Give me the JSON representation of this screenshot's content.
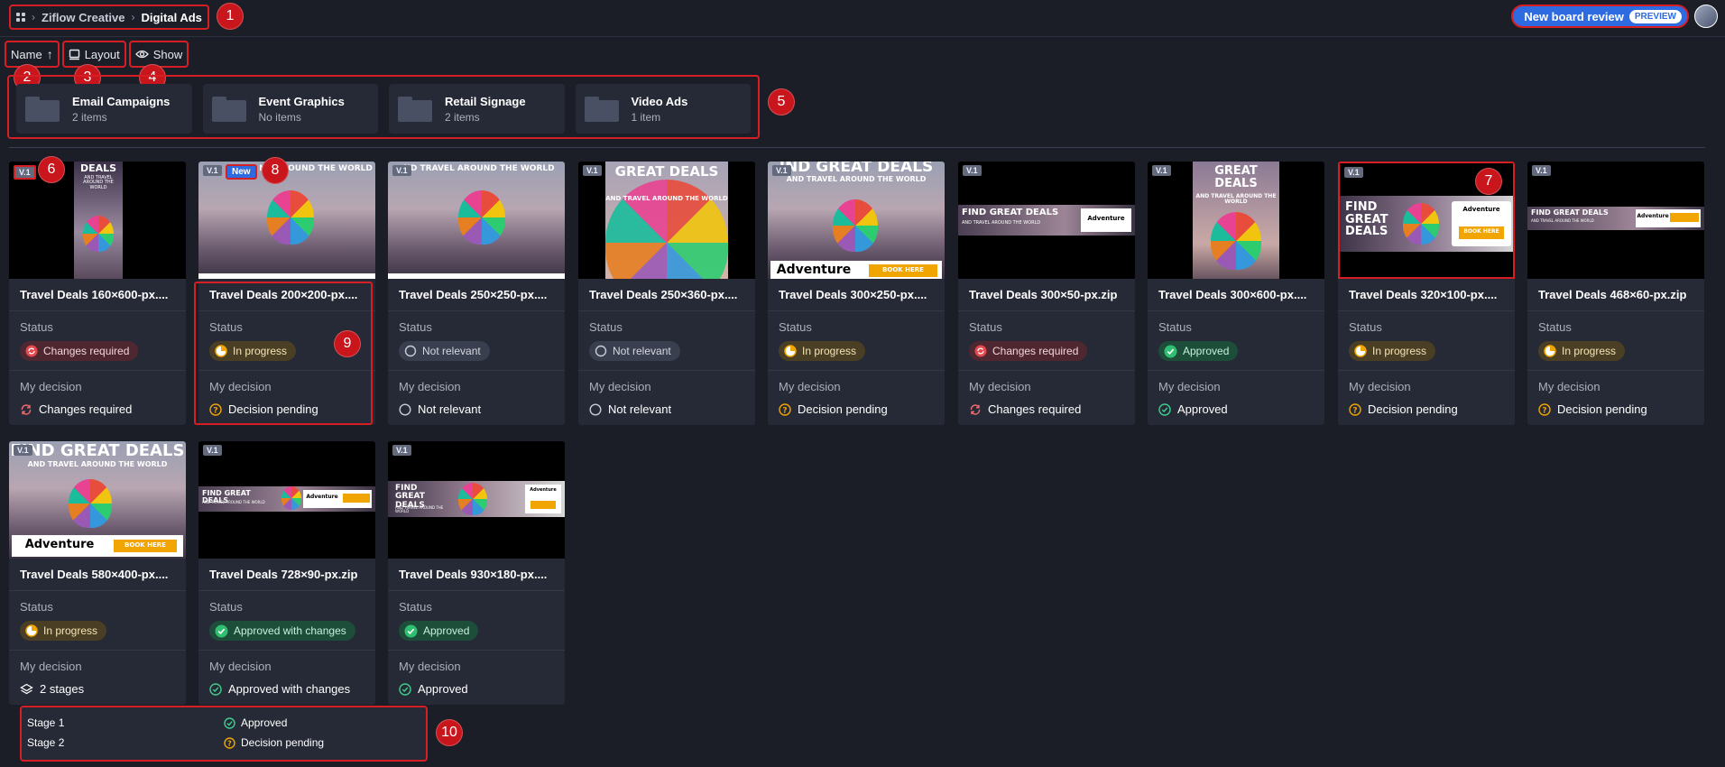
{
  "breadcrumb": {
    "items": [
      "Ziflow Creative",
      "Digital Ads"
    ]
  },
  "header": {
    "review_button": "New board review",
    "preview_pill": "PREVIEW"
  },
  "toolbar": {
    "sort_label": "Name",
    "sort_arrow": "↑",
    "layout_label": "Layout",
    "show_label": "Show"
  },
  "folders": [
    {
      "name": "Email Campaigns",
      "count": "2 items"
    },
    {
      "name": "Event Graphics",
      "count": "No items"
    },
    {
      "name": "Retail Signage",
      "count": "2 items"
    },
    {
      "name": "Video Ads",
      "count": "1 item"
    }
  ],
  "labels": {
    "status": "Status",
    "decision": "My decision"
  },
  "assets": [
    {
      "title": "Travel Deals 160×600-px....",
      "version": "V.1",
      "status": "Changes required",
      "status_color": "red",
      "decision": "Changes required",
      "decision_icon": "refresh-icon"
    },
    {
      "title": "Travel Deals 200×200-px....",
      "version": "V.1",
      "new_badge": "New",
      "status": "In progress",
      "status_color": "yellow",
      "decision": "Decision pending",
      "decision_icon": "question-icon"
    },
    {
      "title": "Travel Deals 250×250-px....",
      "version": "V.1",
      "status": "Not relevant",
      "status_color": "gray",
      "decision": "Not relevant",
      "decision_icon": "circle-icon"
    },
    {
      "title": "Travel Deals 250×360-px....",
      "version": "V.1",
      "status": "Not relevant",
      "status_color": "gray",
      "decision": "Not relevant",
      "decision_icon": "circle-icon"
    },
    {
      "title": "Travel Deals 300×250-px....",
      "version": "V.1",
      "status": "In progress",
      "status_color": "yellow",
      "decision": "Decision pending",
      "decision_icon": "question-icon"
    },
    {
      "title": "Travel Deals 300×50-px.zip",
      "version": "V.1",
      "status": "Changes required",
      "status_color": "red",
      "decision": "Changes required",
      "decision_icon": "refresh-icon"
    },
    {
      "title": "Travel Deals 300×600-px....",
      "version": "V.1",
      "status": "Approved",
      "status_color": "green",
      "decision": "Approved",
      "decision_icon": "check-icon"
    },
    {
      "title": "Travel Deals 320×100-px....",
      "version": "V.1",
      "status": "In progress",
      "status_color": "yellow",
      "decision": "Decision pending",
      "decision_icon": "question-icon"
    },
    {
      "title": "Travel Deals 468×60-px.zip",
      "version": "V.1",
      "status": "In progress",
      "status_color": "yellow",
      "decision": "Decision pending",
      "decision_icon": "question-icon"
    },
    {
      "title": "Travel Deals 580×400-px....",
      "version": "V.1",
      "status": "In progress",
      "status_color": "yellow",
      "decision": "2 stages",
      "decision_icon": "layers-icon"
    },
    {
      "title": "Travel Deals 728×90-px.zip",
      "version": "V.1",
      "status": "Approved with changes",
      "status_color": "green",
      "decision": "Approved with changes",
      "decision_icon": "check-icon"
    },
    {
      "title": "Travel Deals 930×180-px....",
      "version": "V.1",
      "status": "Approved",
      "status_color": "green",
      "decision": "Approved",
      "decision_icon": "check-icon"
    }
  ],
  "ad_text": {
    "deals": "DEALS",
    "travel_small": "AND TRAVEL AROUND THE WORLD",
    "travel_around": "ND TRAVEL AROUND THE WORLD",
    "nd_around": "ND AROUND THE WORLD",
    "great_deals": "GREAT DEALS",
    "great_deals_cut": "GREAT DEALS",
    "find_great_deals": "FIND GREAT DEALS",
    "find_great_deals_cut": "IND GREAT DEALS",
    "adventure": "Adventure",
    "book_here": "BOOK HERE",
    "find_great_deals_stack": "FIND GREAT DEALS",
    "find_great_deals_two": "FIND GREAT DEALS"
  },
  "stages_tooltip": [
    {
      "stage": "Stage 1",
      "decision": "Approved",
      "icon": "check-icon"
    },
    {
      "stage": "Stage 2",
      "decision": "Decision pending",
      "icon": "question-icon"
    }
  ],
  "markers": [
    "1",
    "2",
    "3",
    "4",
    "5",
    "6",
    "7",
    "8",
    "9",
    "10"
  ],
  "colors": {
    "background": "#1b1e27",
    "card": "#262a36",
    "accent_blue": "#2e6be0",
    "annotation_red": "#d51f25"
  }
}
